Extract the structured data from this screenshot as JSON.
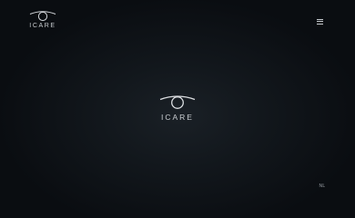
{
  "header": {
    "logo_text": "ICARE",
    "logo_icon": "eye-icon",
    "menu_icon": "hamburger-menu-icon"
  },
  "hero": {
    "logo_text": "ICARE",
    "logo_icon": "eye-icon"
  },
  "footer": {
    "language_label": "NL"
  },
  "colors": {
    "background": "#0b0e12",
    "text": "#c9cdd1"
  }
}
